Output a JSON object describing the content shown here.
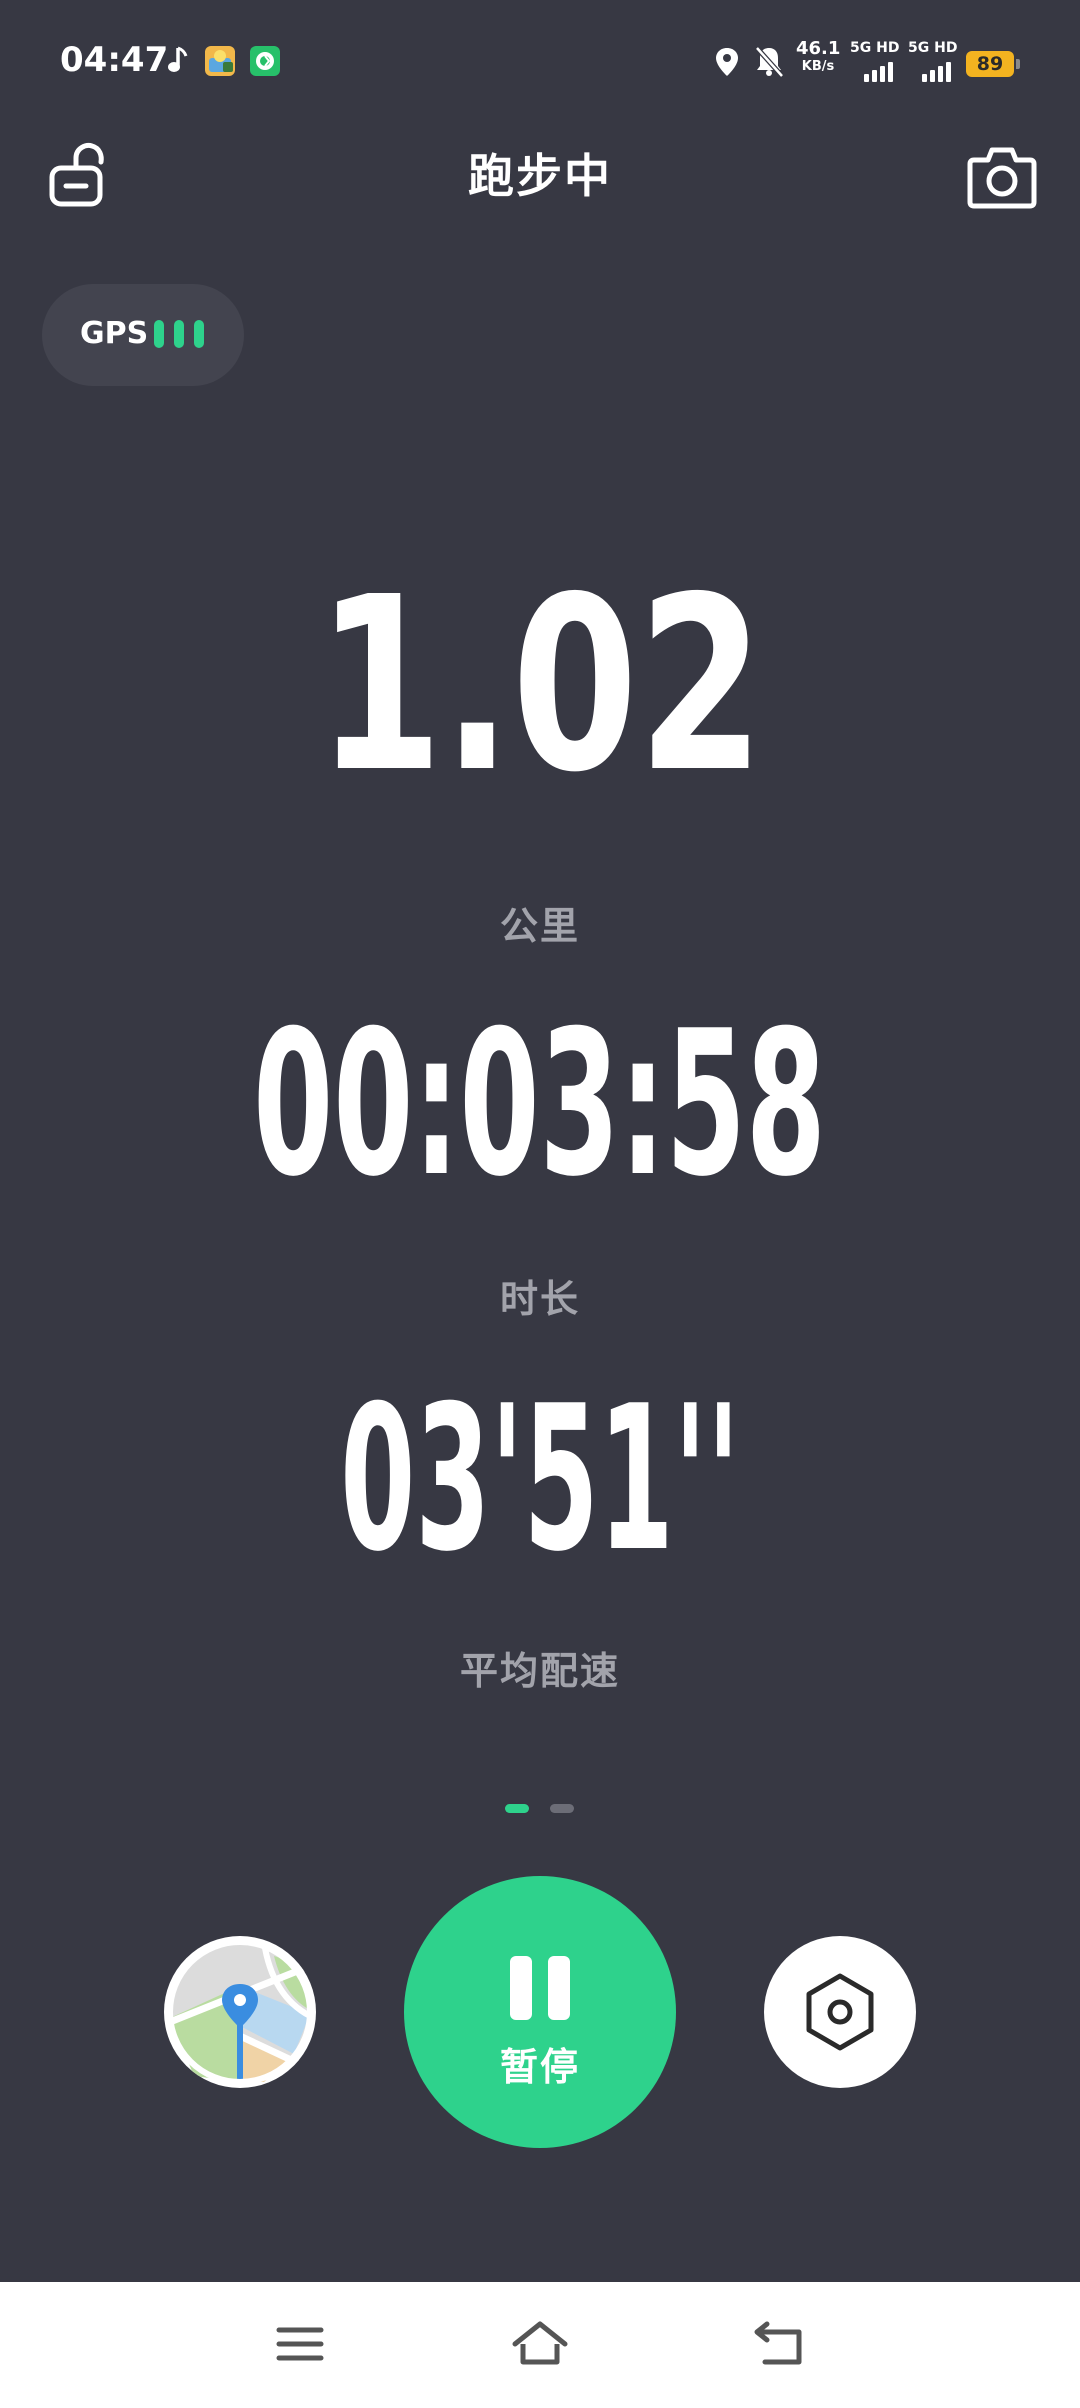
{
  "status_bar": {
    "time": "04:47",
    "network_rate": "46.1",
    "network_rate_unit": "KB/s",
    "signal1_label": "5G HD",
    "signal2_label": "5G HD",
    "battery": "89",
    "icons": [
      "music-note-icon",
      "app-notification-icon",
      "app-notification-icon",
      "location-icon",
      "mute-bell-icon",
      "signal-icon",
      "signal-icon",
      "battery-icon"
    ]
  },
  "header": {
    "title": "跑步中",
    "left_icon": "unlock-icon",
    "right_icon": "camera-icon"
  },
  "gps": {
    "label": "GPS",
    "strength_bars": 3,
    "color": "#2ed28c"
  },
  "metrics": {
    "distance": {
      "value": "1.02",
      "label": "公里"
    },
    "duration": {
      "value": "00:03:58",
      "label": "时长"
    },
    "pace": {
      "value": "03'51''",
      "label": "平均配速"
    }
  },
  "pager": {
    "count": 2,
    "active": 1
  },
  "controls": {
    "map_icon": "map-pin-icon",
    "pause_label": "暂停",
    "pause_icon": "pause-icon",
    "settings_icon": "hexagon-settings-icon"
  },
  "nav_bar": {
    "icons": [
      "menu-icon",
      "home-icon",
      "back-icon"
    ]
  },
  "colors": {
    "background": "#373843",
    "accent": "#2ed28c",
    "label": "#a2a3ab",
    "battery": "#f3b320"
  }
}
